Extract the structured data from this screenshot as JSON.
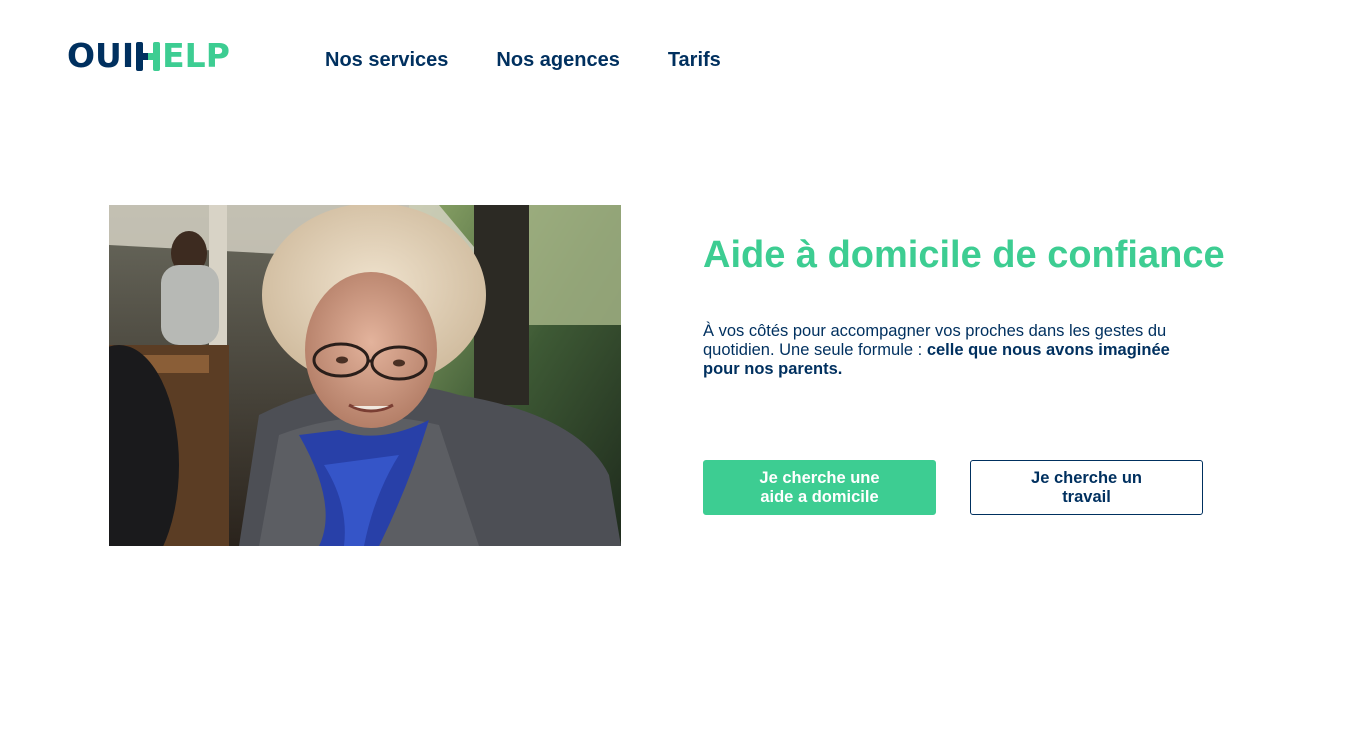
{
  "header": {
    "logo": {
      "part1": "OUI",
      "part2": "ELP"
    },
    "nav": [
      {
        "label": "Nos services"
      },
      {
        "label": "Nos agences"
      },
      {
        "label": "Tarifs"
      }
    ]
  },
  "hero": {
    "title": "Aide à domicile de confiance",
    "description_plain": "À vos côtés pour accompagner vos proches dans les gestes du quotidien. Une seule formule : ",
    "description_bold": "celle que nous avons imaginée pour nos parents.",
    "primary_button": "Je cherche une aide a domicile",
    "secondary_button": "Je cherche un travail"
  },
  "colors": {
    "brand_navy": "#00305f",
    "brand_green": "#3dcd92"
  }
}
